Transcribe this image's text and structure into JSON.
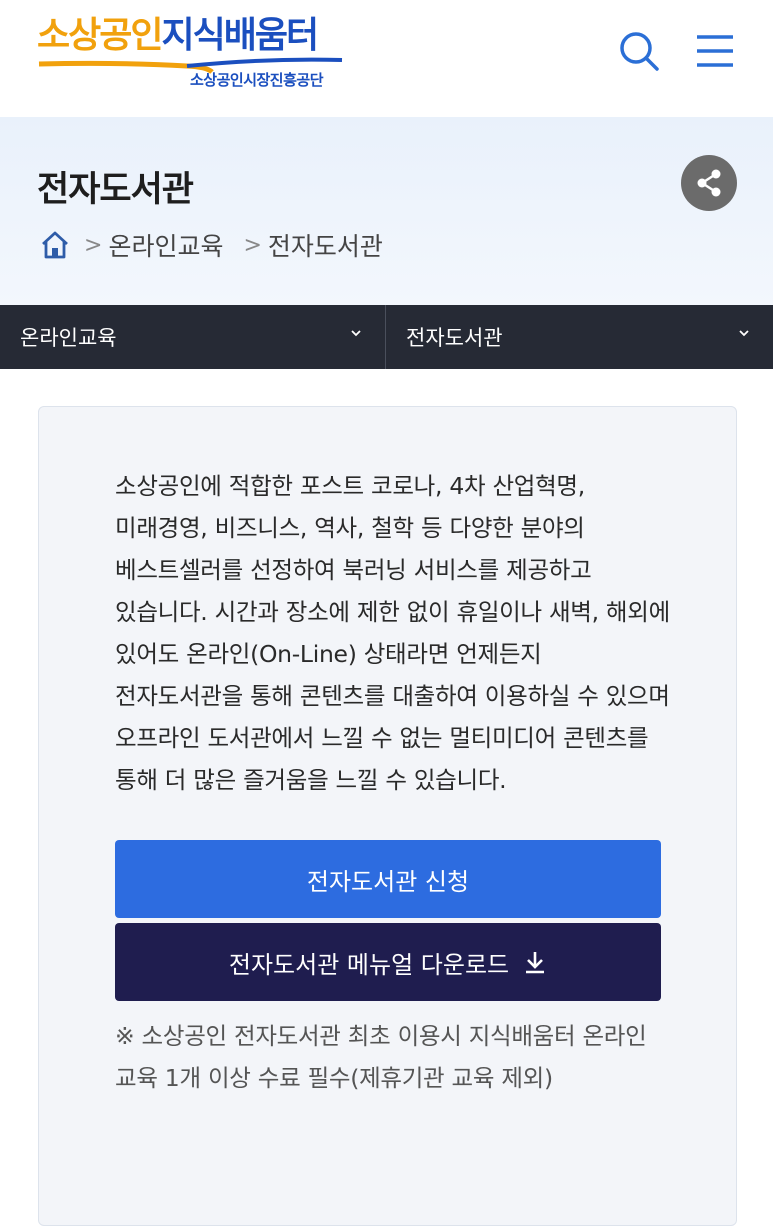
{
  "header": {
    "logo_part1": "소상공인",
    "logo_part2": "지식배움터",
    "logo_sub": "소상공인시장진흥공단",
    "search_icon": "search-icon",
    "menu_icon": "hamburger-menu-icon"
  },
  "title_area": {
    "title": "전자도서관",
    "share_icon": "share-icon",
    "breadcrumb": {
      "home_icon": "home-icon",
      "items": [
        "온라인교육",
        "전자도서관"
      ]
    }
  },
  "subnav": {
    "first": "온라인교육",
    "second": "전자도서관"
  },
  "content": {
    "description": "소상공인에 적합한 포스트 코로나, 4차 산업혁명, 미래경영, 비즈니스, 역사, 철학 등 다양한 분야의 베스트셀러를 선정하여 북러닝 서비스를 제공하고 있습니다. 시간과 장소에 제한 없이 휴일이나 새벽, 해외에 있어도 온라인(On-Line) 상태라면 언제든지 전자도서관을 통해 콘텐츠를 대출하여 이용하실 수 있으며 오프라인 도서관에서 느낄 수 없는 멀티미디어 콘텐츠를 통해 더 많은 즐거움을 느낄 수 있습니다.",
    "apply_button": "전자도서관 신청",
    "manual_button": "전자도서관 메뉴얼 다운로드",
    "download_icon": "download-icon",
    "notice": "※ 소상공인 전자도서관 최초 이용시 지식배움터 온라인 교육 1개 이상 수료 필수(제휴기관 교육 제외)"
  },
  "colors": {
    "logo_orange": "#f1a10d",
    "logo_blue": "#1b4fbf",
    "apply_button": "#2d6ce0",
    "manual_button": "#1f1d4f",
    "subnav_bg": "#262a35"
  }
}
